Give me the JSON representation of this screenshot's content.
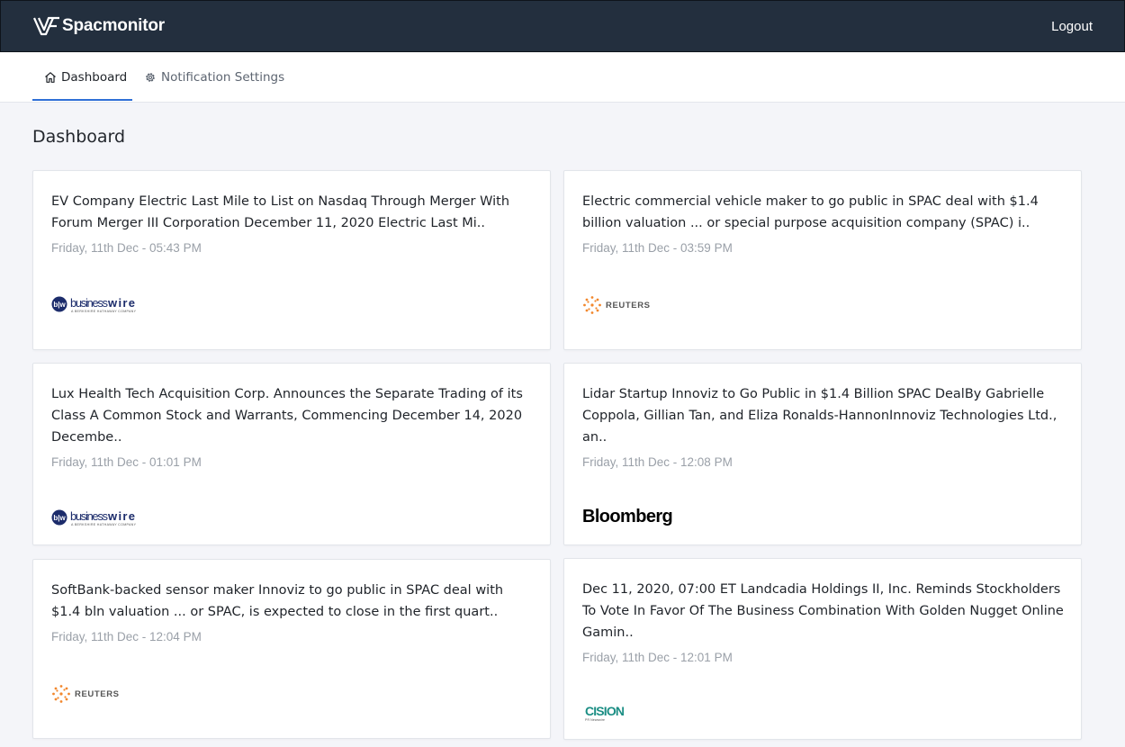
{
  "app": {
    "name": "Spacmonitor",
    "logout_label": "Logout"
  },
  "tabs": [
    {
      "label": "Dashboard",
      "icon": "home-icon",
      "active": true
    },
    {
      "label": "Notification Settings",
      "icon": "gear-icon",
      "active": false
    }
  ],
  "colors": {
    "topbar": "#232f3e",
    "accent": "#2f6fd6",
    "background": "#f4f5f9"
  },
  "page": {
    "title": "Dashboard"
  },
  "cards": [
    {
      "title": "EV Company Electric Last Mile to List on Nasdaq Through Merger With Forum Merger III Corporation December 11, 2020 Electric Last Mi..",
      "date": "Friday, 11th Dec - 05:43 PM",
      "source": "businesswire",
      "source_tagline": "A BERKSHIRE HATHAWAY COMPANY"
    },
    {
      "title": "Electric commercial vehicle maker to go public in SPAC deal with $1.4 billion valuation ... or special purpose acquisition company (SPAC) i..",
      "date": "Friday, 11th Dec - 03:59 PM",
      "source": "REUTERS"
    },
    {
      "title": "Lux Health Tech Acquisition Corp. Announces the Separate Trading of its Class A Common Stock and Warrants, Commencing December 14, 2020 Decembe..",
      "date": "Friday, 11th Dec - 01:01 PM",
      "source": "businesswire",
      "source_tagline": "A BERKSHIRE HATHAWAY COMPANY"
    },
    {
      "title": "Lidar Startup Innoviz to Go Public in $1.4 Billion SPAC DealBy Gabrielle Coppola, Gillian Tan, and Eliza Ronalds-HannonInnoviz Technologies Ltd., an..",
      "date": "Friday, 11th Dec - 12:08 PM",
      "source": "Bloomberg"
    },
    {
      "title": "SoftBank-backed sensor maker Innoviz to go public in SPAC deal with $1.4 bln valuation ... or SPAC, is expected to close in the first quart..",
      "date": "Friday, 11th Dec - 12:04 PM",
      "source": "REUTERS"
    },
    {
      "title": "Dec 11, 2020, 07:00 ET Landcadia Holdings II, Inc. Reminds Stockholders To Vote In Favor Of The Business Combination With Golden Nugget Online Gamin..",
      "date": "Friday, 11th Dec - 12:01 PM",
      "source": "CISION",
      "source_tagline": "PR Newswire"
    }
  ]
}
